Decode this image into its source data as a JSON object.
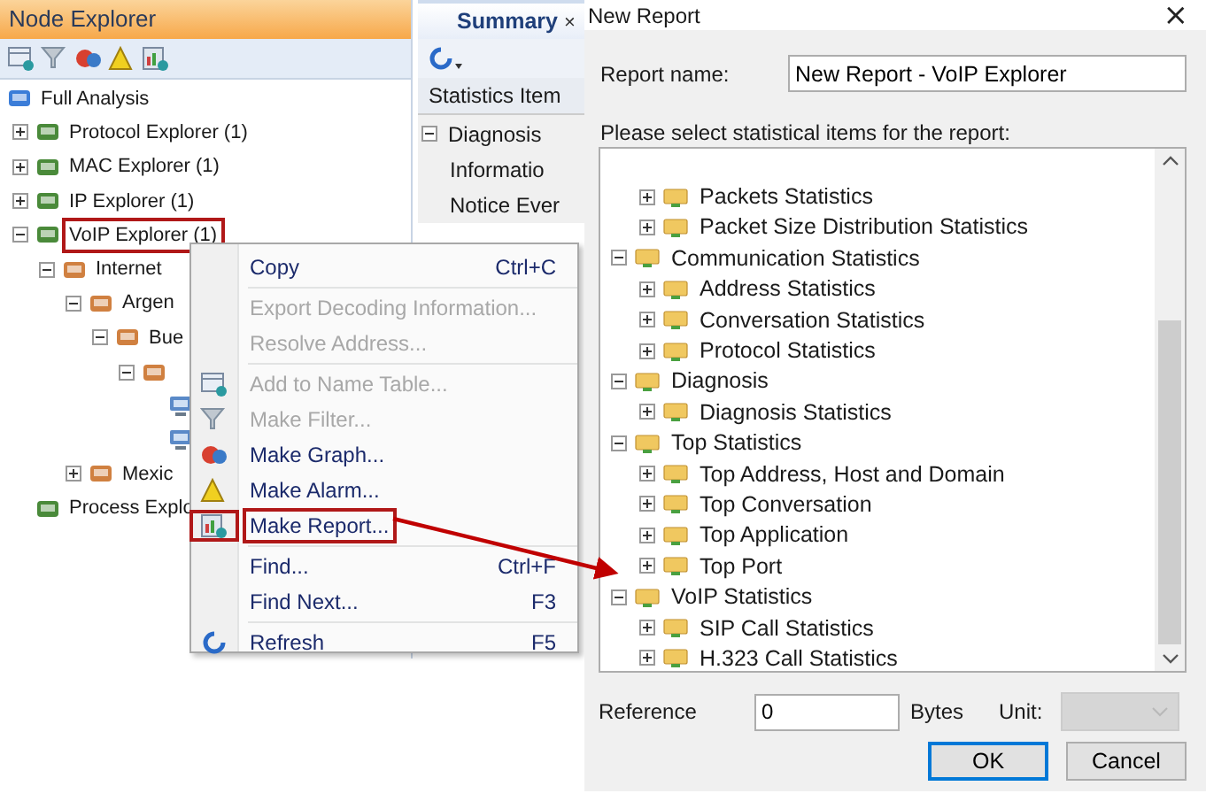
{
  "node_explorer": {
    "title": "Node Explorer",
    "tree": [
      {
        "label": "Full Analysis",
        "children": [
          {
            "label": "Protocol Explorer (1)",
            "expanded": false
          },
          {
            "label": "MAC Explorer (1)",
            "expanded": false
          },
          {
            "label": "IP Explorer (1)",
            "expanded": false
          },
          {
            "label": "VoIP Explorer (1)",
            "expanded": true,
            "highlighted": true,
            "children": [
              {
                "label": "Internet",
                "expanded": true,
                "children": [
                  {
                    "label": "Argen",
                    "expanded": true,
                    "children": [
                      {
                        "label": "Bue",
                        "expanded": true,
                        "children": [
                          {
                            "expanded": true,
                            "children": [
                              {
                                "kind": "host"
                              },
                              {
                                "kind": "host"
                              }
                            ]
                          }
                        ]
                      }
                    ]
                  },
                  {
                    "label": "Mexic",
                    "expanded": false
                  }
                ]
              }
            ]
          },
          {
            "label": "Process Explo"
          }
        ]
      }
    ]
  },
  "summary": {
    "tab": "Summary",
    "close": "×",
    "column": "Statistics Item",
    "rows": [
      {
        "label": "Diagnosis",
        "expanded": true
      },
      {
        "label": "Informatio"
      },
      {
        "label": "Notice Ever"
      }
    ]
  },
  "context_menu": [
    {
      "label": "Copy",
      "shortcut": "Ctrl+C",
      "disabled": false
    },
    {
      "kind": "separator"
    },
    {
      "label": "Export Decoding Information...",
      "disabled": true
    },
    {
      "label": "Resolve Address...",
      "disabled": true
    },
    {
      "kind": "separator"
    },
    {
      "label": "Add to Name Table...",
      "disabled": true
    },
    {
      "label": "Make Filter...",
      "disabled": true
    },
    {
      "label": "Make Graph...",
      "disabled": false
    },
    {
      "label": "Make Alarm...",
      "disabled": false
    },
    {
      "label": "Make Report...",
      "disabled": false,
      "highlighted": true
    },
    {
      "kind": "separator"
    },
    {
      "label": "Find...",
      "shortcut": "Ctrl+F",
      "disabled": false
    },
    {
      "label": "Find Next...",
      "shortcut": "F3",
      "disabled": false
    },
    {
      "kind": "separator"
    },
    {
      "label": "Refresh",
      "shortcut": "F5",
      "disabled": false
    }
  ],
  "dialog": {
    "title": "New Report",
    "close": "×",
    "report_name_label": "Report name:",
    "report_name": "New Report - VoIP Explorer",
    "prompt": "Please select statistical items for the report:",
    "tree": [
      {
        "children": [
          {
            "label": "Packets Statistics",
            "expanded": false
          },
          {
            "label": "Packet Size Distribution Statistics",
            "expanded": false
          }
        ]
      },
      {
        "label": "Communication Statistics",
        "expanded": true,
        "children": [
          {
            "label": "Address Statistics",
            "expanded": false
          },
          {
            "label": "Conversation Statistics",
            "expanded": false
          },
          {
            "label": "Protocol Statistics",
            "expanded": false
          }
        ]
      },
      {
        "label": "Diagnosis",
        "expanded": true,
        "children": [
          {
            "label": "Diagnosis Statistics",
            "expanded": false
          }
        ]
      },
      {
        "label": "Top Statistics",
        "expanded": true,
        "children": [
          {
            "label": "Top Address, Host and Domain",
            "expanded": false
          },
          {
            "label": "Top Conversation",
            "expanded": false
          },
          {
            "label": "Top Application",
            "expanded": false
          },
          {
            "label": "Top Port",
            "expanded": false
          }
        ]
      },
      {
        "label": "VoIP Statistics",
        "expanded": true,
        "children": [
          {
            "label": "SIP Call Statistics",
            "expanded": false
          },
          {
            "label": "H.323 Call Statistics",
            "expanded": false
          }
        ]
      }
    ],
    "reference_label": "Reference",
    "reference": "0",
    "unit_bytes": "Bytes",
    "unit_label": "Unit:",
    "buttons": [
      {
        "label": "OK",
        "default": true
      },
      {
        "label": "Cancel",
        "default": false
      }
    ]
  }
}
